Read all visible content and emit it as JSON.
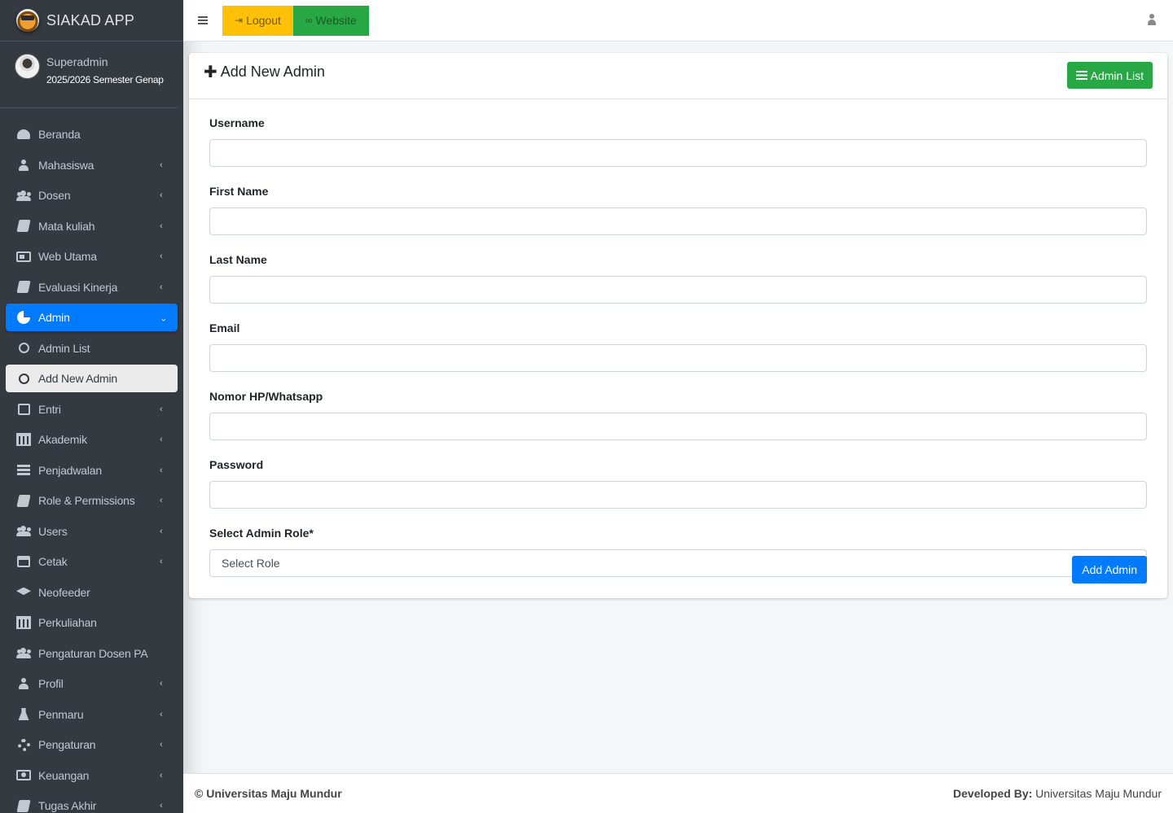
{
  "brand": {
    "title": "SIAKAD APP"
  },
  "user": {
    "name": "Superadmin",
    "semester": "2025/2026 Semester Genap"
  },
  "sidebar": {
    "items": [
      {
        "label": "Beranda",
        "icon": "dashboard-icon",
        "chevron": false
      },
      {
        "label": "Mahasiswa",
        "icon": "user-icon",
        "chevron": true
      },
      {
        "label": "Dosen",
        "icon": "users-icon",
        "chevron": true
      },
      {
        "label": "Mata kuliah",
        "icon": "book-icon",
        "chevron": true
      },
      {
        "label": "Web Utama",
        "icon": "newspaper-icon",
        "chevron": true
      },
      {
        "label": "Evaluasi Kinerja",
        "icon": "book-icon",
        "chevron": true
      },
      {
        "label": "Admin",
        "icon": "pie-chart-icon",
        "chevron": true,
        "expanded": true
      },
      {
        "label": "Admin List",
        "icon": "circle-icon"
      },
      {
        "label": "Add New Admin",
        "icon": "circle-icon",
        "current": true
      },
      {
        "label": "Entri",
        "icon": "edit-icon",
        "chevron": true
      },
      {
        "label": "Akademik",
        "icon": "university-icon",
        "chevron": true
      },
      {
        "label": "Penjadwalan",
        "icon": "list-icon",
        "chevron": true
      },
      {
        "label": "Role & Permissions",
        "icon": "book-icon",
        "chevron": true
      },
      {
        "label": "Users",
        "icon": "users-icon",
        "chevron": true
      },
      {
        "label": "Cetak",
        "icon": "print-icon",
        "chevron": true
      },
      {
        "label": "Neofeeder",
        "icon": "graduation-cap-icon",
        "chevron": false
      },
      {
        "label": "Perkuliahan",
        "icon": "university-icon",
        "chevron": false
      },
      {
        "label": "Pengaturan Dosen PA",
        "icon": "users-icon",
        "chevron": false
      },
      {
        "label": "Profil",
        "icon": "user-icon",
        "chevron": true
      },
      {
        "label": "Penmaru",
        "icon": "flask-icon",
        "chevron": true
      },
      {
        "label": "Pengaturan",
        "icon": "cog-icon",
        "chevron": true
      },
      {
        "label": "Keuangan",
        "icon": "money-icon",
        "chevron": true
      },
      {
        "label": "Tugas Akhir",
        "icon": "book-icon",
        "chevron": true
      }
    ]
  },
  "topbar": {
    "logout_label": "Logout",
    "website_label": "Website"
  },
  "card": {
    "title": "Add New Admin",
    "admin_list_label": "Admin List"
  },
  "form": {
    "username_label": "Username",
    "first_name_label": "First Name",
    "last_name_label": "Last Name",
    "email_label": "Email",
    "phone_label": "Nomor HP/Whatsapp",
    "password_label": "Password",
    "role_label": "Select Admin Role*",
    "role_selected": "Select Role",
    "submit_label": "Add Admin"
  },
  "footer": {
    "copyright": "© Universitas Maju Mundur",
    "dev_prefix": "Developed By:",
    "dev_name": " Universitas Maju Mundur"
  },
  "colors": {
    "sidebar_bg": "#343a40",
    "primary": "#007bff",
    "success": "#28a745",
    "warning": "#ffc107"
  }
}
